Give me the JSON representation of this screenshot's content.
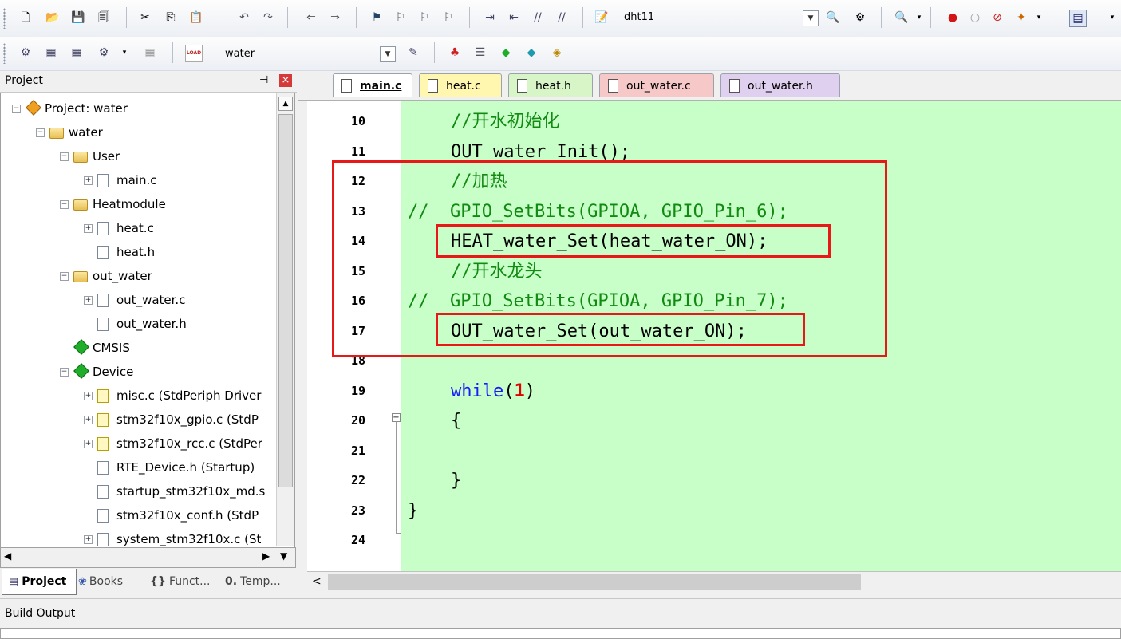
{
  "toolbar1": {
    "target_name": "dht11"
  },
  "toolbar2": {
    "target_name": "water",
    "load_icon_text": "LOAD"
  },
  "project_panel": {
    "title": "Project",
    "pin_glyph": "⊣",
    "close_glyph": "×",
    "tree": [
      {
        "label": "Project: water",
        "level": 0,
        "icon": "project-icon",
        "expander": "−"
      },
      {
        "label": "water",
        "level": 1,
        "icon": "target-icon",
        "expander": "−"
      },
      {
        "label": "User",
        "level": 2,
        "icon": "folder-icon",
        "expander": "−"
      },
      {
        "label": "main.c",
        "level": 3,
        "icon": "file-icon",
        "expander": "+"
      },
      {
        "label": "Heatmodule",
        "level": 2,
        "icon": "folder-icon",
        "expander": "−"
      },
      {
        "label": "heat.c",
        "level": 3,
        "icon": "file-icon",
        "expander": "+"
      },
      {
        "label": "heat.h",
        "level": 3,
        "icon": "file-icon",
        "expander": ""
      },
      {
        "label": "out_water",
        "level": 2,
        "icon": "folder-icon",
        "expander": "−"
      },
      {
        "label": "out_water.c",
        "level": 3,
        "icon": "file-icon",
        "expander": "+"
      },
      {
        "label": "out_water.h",
        "level": 3,
        "icon": "file-icon",
        "expander": ""
      },
      {
        "label": "CMSIS",
        "level": 2,
        "icon": "component-icon",
        "expander": ""
      },
      {
        "label": "Device",
        "level": 2,
        "icon": "component-icon",
        "expander": "−"
      },
      {
        "label": "misc.c (StdPeriph Driver",
        "level": 3,
        "icon": "key-file-icon",
        "expander": "+"
      },
      {
        "label": "stm32f10x_gpio.c (StdP",
        "level": 3,
        "icon": "key-file-icon",
        "expander": "+"
      },
      {
        "label": "stm32f10x_rcc.c (StdPer",
        "level": 3,
        "icon": "key-file-icon",
        "expander": "+"
      },
      {
        "label": "RTE_Device.h (Startup)",
        "level": 3,
        "icon": "file-icon",
        "expander": ""
      },
      {
        "label": "startup_stm32f10x_md.s",
        "level": 3,
        "icon": "file-icon",
        "expander": ""
      },
      {
        "label": "stm32f10x_conf.h (StdP",
        "level": 3,
        "icon": "file-icon",
        "expander": ""
      },
      {
        "label": "system_stm32f10x.c (St",
        "level": 3,
        "icon": "file-icon",
        "expander": "+"
      }
    ],
    "tabs": [
      {
        "label": "Project"
      },
      {
        "label": "Books"
      },
      {
        "label": "Funct..."
      },
      {
        "label": "Temp..."
      }
    ],
    "tab_glyphs": [
      "▤",
      "❀",
      "{}",
      "0."
    ]
  },
  "editor": {
    "tabs": [
      {
        "label": "main.c",
        "color": "#ffffff",
        "active": true
      },
      {
        "label": "heat.c",
        "color": "#fff6b0"
      },
      {
        "label": "heat.h",
        "color": "#d8f5c8"
      },
      {
        "label": "out_water.c",
        "color": "#f6c8c8"
      },
      {
        "label": "out_water.h",
        "color": "#e0d0f0"
      }
    ],
    "lines": [
      {
        "num": "10",
        "text": "    //开水初始化"
      },
      {
        "num": "11",
        "text": "    OUT_water_Init();"
      },
      {
        "num": "12",
        "text": "    //加热"
      },
      {
        "num": "13",
        "text": "//  GPIO_SetBits(GPIOA, GPIO_Pin_6);"
      },
      {
        "num": "14",
        "text": "    HEAT_water_Set(heat_water_ON);"
      },
      {
        "num": "15",
        "text": "    //开水龙头"
      },
      {
        "num": "16",
        "text": "//  GPIO_SetBits(GPIOA, GPIO_Pin_7);"
      },
      {
        "num": "17",
        "text": "    OUT_water_Set(out_water_ON);"
      },
      {
        "num": "18",
        "text": ""
      },
      {
        "num": "19",
        "kw": "while",
        "open": "(",
        "num_lit": "1",
        "close": ")"
      },
      {
        "num": "20",
        "text": "    {"
      },
      {
        "num": "21",
        "text": ""
      },
      {
        "num": "22",
        "text": "    }"
      },
      {
        "num": "23",
        "text": "}"
      },
      {
        "num": "24",
        "text": ""
      }
    ],
    "fold_glyph": "−",
    "scroll_left_glyph": "<"
  },
  "build_output": {
    "title": "Build Output"
  },
  "colors": {
    "editor_bg": "#c8ffc8",
    "comment": "#108a10",
    "keyword": "#1a1aff",
    "number": "#e00000",
    "highlight_box": "#e81818"
  }
}
